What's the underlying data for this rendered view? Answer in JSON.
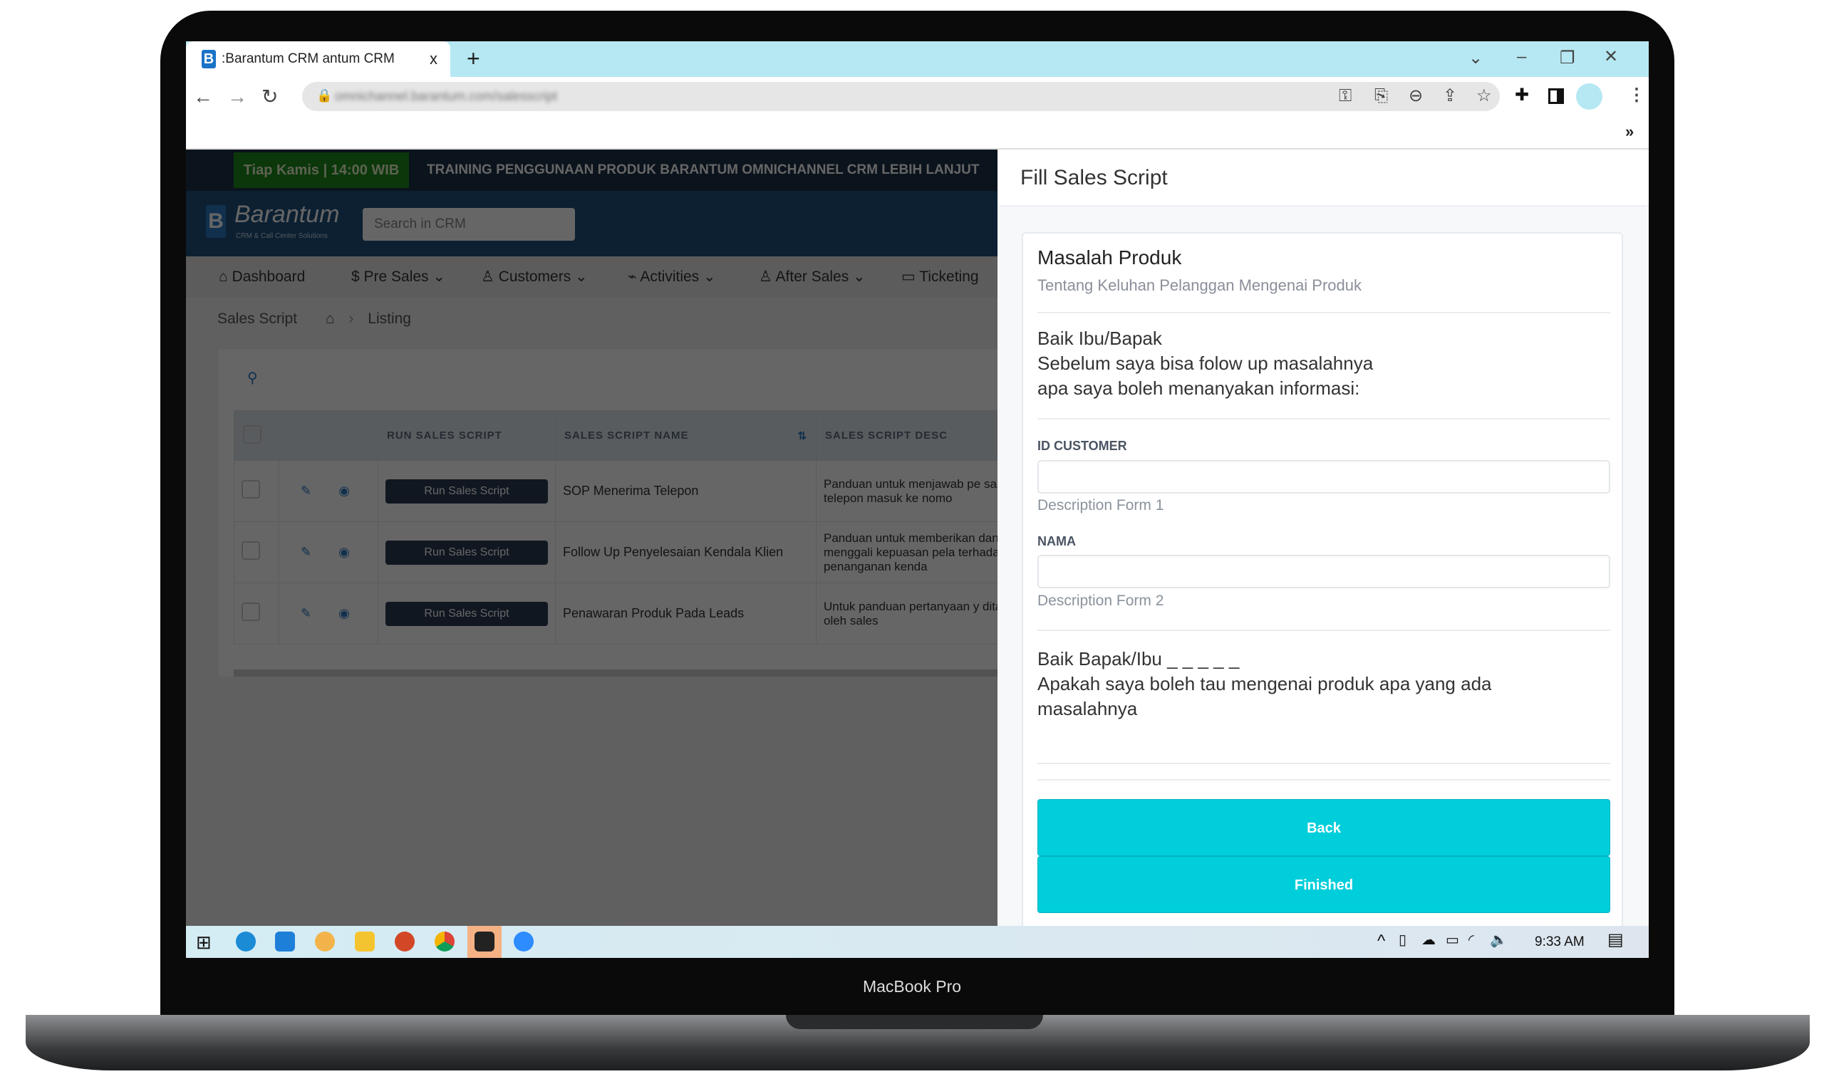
{
  "device": {
    "label": "MacBook Pro"
  },
  "browser": {
    "tab_title": ":Barantum CRM  antum CRM",
    "new_tab": "+",
    "close_tab": "x",
    "url": "omnichannel.barantum.com/salesscript",
    "bookmarks_more": "»"
  },
  "banner": {
    "schedule": "Tiap Kamis | 14:00 WIB",
    "text": "TRAINING PENGGUNAAN PRODUK BARANTUM OMNICHANNEL CRM LEBIH LANJUT"
  },
  "header": {
    "logo": "Barantum",
    "logo_tagline": "CRM & Call Center Solutions",
    "search_placeholder": "Search in CRM"
  },
  "nav": [
    {
      "label": "Dashboard",
      "icon": "home-icon"
    },
    {
      "label": "Pre Sales",
      "icon": "dollar-icon"
    },
    {
      "label": "Customers",
      "icon": "users-icon"
    },
    {
      "label": "Activities",
      "icon": "activity-icon"
    },
    {
      "label": "After Sales",
      "icon": "users-icon"
    },
    {
      "label": "Ticketing",
      "icon": "folder-icon"
    }
  ],
  "breadcrumb": {
    "title": "Sales Script",
    "current": "Listing"
  },
  "table": {
    "headers": [
      "",
      "",
      "RUN SALES SCRIPT",
      "SALES SCRIPT NAME",
      "SALES SCRIPT DESC"
    ],
    "rows": [
      {
        "run": "Run Sales Script",
        "name": "SOP Menerima Telepon",
        "desc": "Panduan untuk menjawab pe saat telepon masuk ke nomo"
      },
      {
        "run": "Run Sales Script",
        "name": "Follow Up Penyelesaian Kendala Klien",
        "desc": "Panduan untuk memberikan dan menggali kepuasan pela terhadap penanganan kenda"
      },
      {
        "run": "Run Sales Script",
        "name": "Penawaran Produk Pada Leads",
        "desc": "Untuk panduan pertanyaan y ditanyakan oleh sales"
      }
    ]
  },
  "panel": {
    "title": "Fill Sales Script",
    "section_title": "Masalah Produk",
    "section_subtitle": "Tentang Keluhan Pelanggan Mengenai Produk",
    "intro": [
      "Baik Ibu/Bapak",
      "Sebelum saya bisa folow up masalahnya",
      "apa saya boleh menanyakan informasi:"
    ],
    "fields": [
      {
        "label": "ID CUSTOMER",
        "value": "",
        "description": "Description Form 1"
      },
      {
        "label": "NAMA",
        "value": "",
        "description": "Description Form 2"
      }
    ],
    "question": [
      "Baik Bapak/Ibu _ _ _ _ _",
      "Apakah saya boleh tau mengenai produk apa yang ada",
      "masalahnya"
    ],
    "back_label": "Back",
    "finished_label": "Finished",
    "accent": "#00cedb"
  },
  "taskbar": {
    "time": "9:33 AM"
  }
}
